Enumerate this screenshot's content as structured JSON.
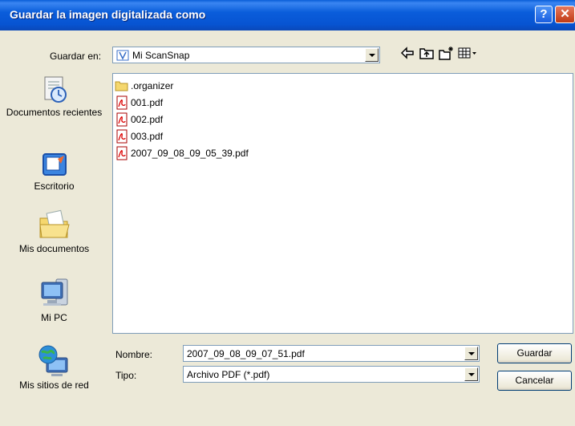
{
  "window": {
    "title": "Guardar la imagen digitalizada como"
  },
  "save_in": {
    "label": "Guardar en:",
    "value": "Mi ScanSnap"
  },
  "places": [
    {
      "label": "Documentos recientes"
    },
    {
      "label": "Escritorio"
    },
    {
      "label": "Mis documentos"
    },
    {
      "label": "Mi PC"
    },
    {
      "label": "Mis sitios de red"
    }
  ],
  "files": [
    {
      "name": ".organizer",
      "icon": "folder-icon"
    },
    {
      "name": "001.pdf",
      "icon": "pdf-icon"
    },
    {
      "name": "002.pdf",
      "icon": "pdf-icon"
    },
    {
      "name": "003.pdf",
      "icon": "pdf-icon"
    },
    {
      "name": "2007_09_08_09_05_39.pdf",
      "icon": "pdf-icon"
    }
  ],
  "filename": {
    "label": "Nombre:",
    "value": "2007_09_08_09_07_51.pdf"
  },
  "filetype": {
    "label": "Tipo:",
    "value": "Archivo PDF (*.pdf)"
  },
  "buttons": {
    "save": "Guardar",
    "cancel": "Cancelar"
  },
  "colors": {
    "titlebar": "#0a5ddb",
    "dialog_bg": "#ece9d8",
    "field_border": "#7f9db9"
  }
}
